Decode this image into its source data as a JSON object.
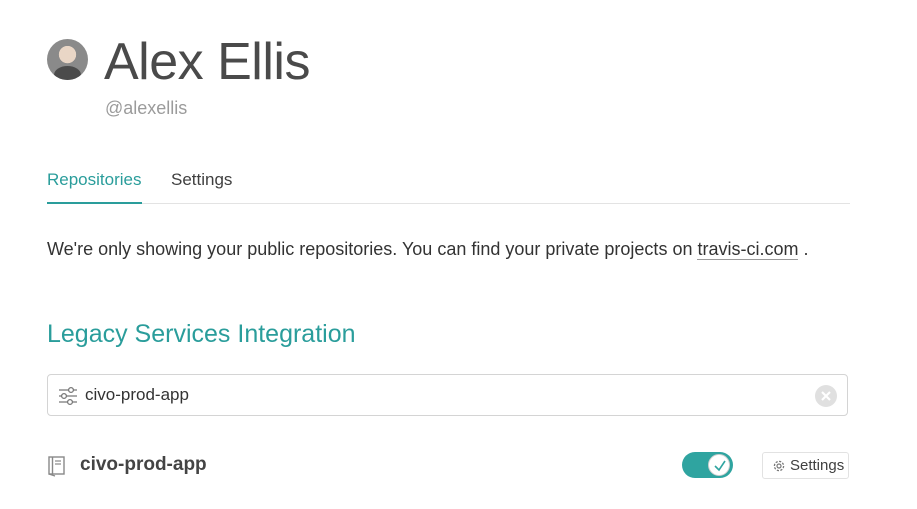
{
  "profile": {
    "name": "Alex Ellis",
    "handle": "@alexellis"
  },
  "tabs": [
    {
      "label": "Repositories",
      "active": true
    },
    {
      "label": "Settings",
      "active": false
    }
  ],
  "notice": {
    "text_before": "We're only showing your public repositories. You can find your private projects on ",
    "link_text": "travis-ci.com",
    "text_after": " ."
  },
  "section": {
    "title": "Legacy Services Integration"
  },
  "filter": {
    "value": "civo-prod-app",
    "icon": "sliders-icon",
    "clear_icon": "clear-icon"
  },
  "repositories": [
    {
      "name": "civo-prod-app",
      "icon": "repo-icon",
      "enabled": true,
      "settings_label": "Settings",
      "settings_icon": "gear-icon"
    }
  ],
  "colors": {
    "accent": "#2a9d9b",
    "toggle_on": "#2fa4a0"
  }
}
